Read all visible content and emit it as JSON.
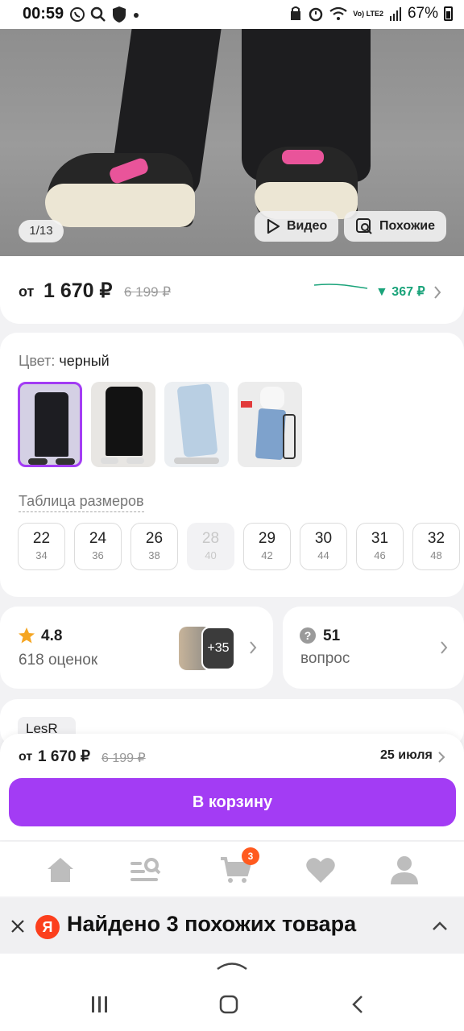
{
  "status_bar": {
    "time": "00:59",
    "battery": "67%",
    "network": "Vo) LTE2"
  },
  "gallery": {
    "counter": "1/13",
    "video_label": "Видео",
    "similar_label": "Похожие"
  },
  "price": {
    "from": "от",
    "current": "1 670 ₽",
    "old": "6 199 ₽",
    "discount": "367 ₽"
  },
  "variants": {
    "color_label": "Цвет:",
    "color_value": "черный",
    "size_table_label": "Таблица размеров",
    "sizes": [
      {
        "ru": "22",
        "eu": "34",
        "available": true
      },
      {
        "ru": "24",
        "eu": "36",
        "available": true
      },
      {
        "ru": "26",
        "eu": "38",
        "available": true
      },
      {
        "ru": "28",
        "eu": "40",
        "available": false
      },
      {
        "ru": "29",
        "eu": "42",
        "available": true
      },
      {
        "ru": "30",
        "eu": "44",
        "available": true
      },
      {
        "ru": "31",
        "eu": "46",
        "available": true
      },
      {
        "ru": "32",
        "eu": "48",
        "available": true
      }
    ]
  },
  "reviews": {
    "rating": "4.8",
    "count_label": "618 оценок",
    "photos_more": "+35"
  },
  "questions": {
    "count": "51",
    "label": "вопрос"
  },
  "brand": {
    "name": "LesR"
  },
  "buy_bar": {
    "from": "от",
    "price": "1 670 ₽",
    "old": "6 199 ₽",
    "delivery": "25 июля",
    "button": "В корзину"
  },
  "nav": {
    "cart_badge": "3"
  },
  "yandex_banner": {
    "logo": "Я",
    "text": "Найдено 3 похожих товара"
  },
  "colors": {
    "accent": "#a33cf4",
    "discount": "#1aa37a",
    "badge": "#ff5a1f",
    "yandex": "#fc3f1d"
  }
}
